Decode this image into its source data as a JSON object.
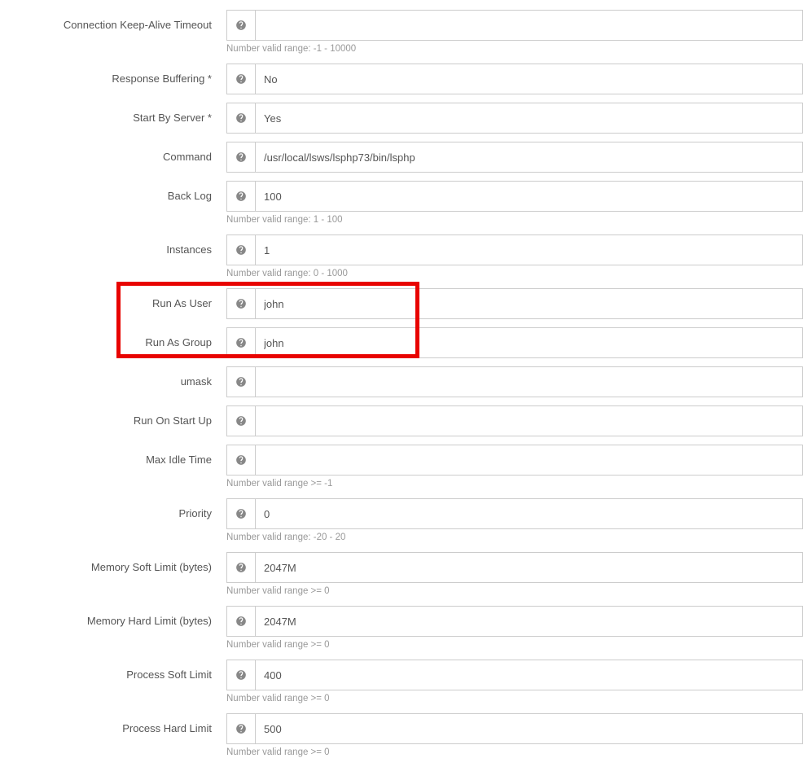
{
  "fields": {
    "keep_alive_timeout": {
      "label": "Connection Keep-Alive Timeout",
      "value": "",
      "hint": "Number valid range: -1 - 10000"
    },
    "response_buffering": {
      "label": "Response Buffering *",
      "value": "No"
    },
    "start_by_server": {
      "label": "Start By Server *",
      "value": "Yes"
    },
    "command": {
      "label": "Command",
      "value": "/usr/local/lsws/lsphp73/bin/lsphp"
    },
    "back_log": {
      "label": "Back Log",
      "value": "100",
      "hint": "Number valid range: 1 - 100"
    },
    "instances": {
      "label": "Instances",
      "value": "1",
      "hint": "Number valid range: 0 - 1000"
    },
    "run_as_user": {
      "label": "Run As User",
      "value": "john"
    },
    "run_as_group": {
      "label": "Run As Group",
      "value": "john"
    },
    "umask": {
      "label": "umask",
      "value": ""
    },
    "run_on_start_up": {
      "label": "Run On Start Up",
      "value": ""
    },
    "max_idle_time": {
      "label": "Max Idle Time",
      "value": "",
      "hint": "Number valid range >= -1"
    },
    "priority": {
      "label": "Priority",
      "value": "0",
      "hint": "Number valid range: -20 - 20"
    },
    "memory_soft_limit": {
      "label": "Memory Soft Limit (bytes)",
      "value": "2047M",
      "hint": "Number valid range >= 0"
    },
    "memory_hard_limit": {
      "label": "Memory Hard Limit (bytes)",
      "value": "2047M",
      "hint": "Number valid range >= 0"
    },
    "process_soft_limit": {
      "label": "Process Soft Limit",
      "value": "400",
      "hint": "Number valid range >= 0"
    },
    "process_hard_limit": {
      "label": "Process Hard Limit",
      "value": "500",
      "hint": "Number valid range >= 0"
    }
  }
}
